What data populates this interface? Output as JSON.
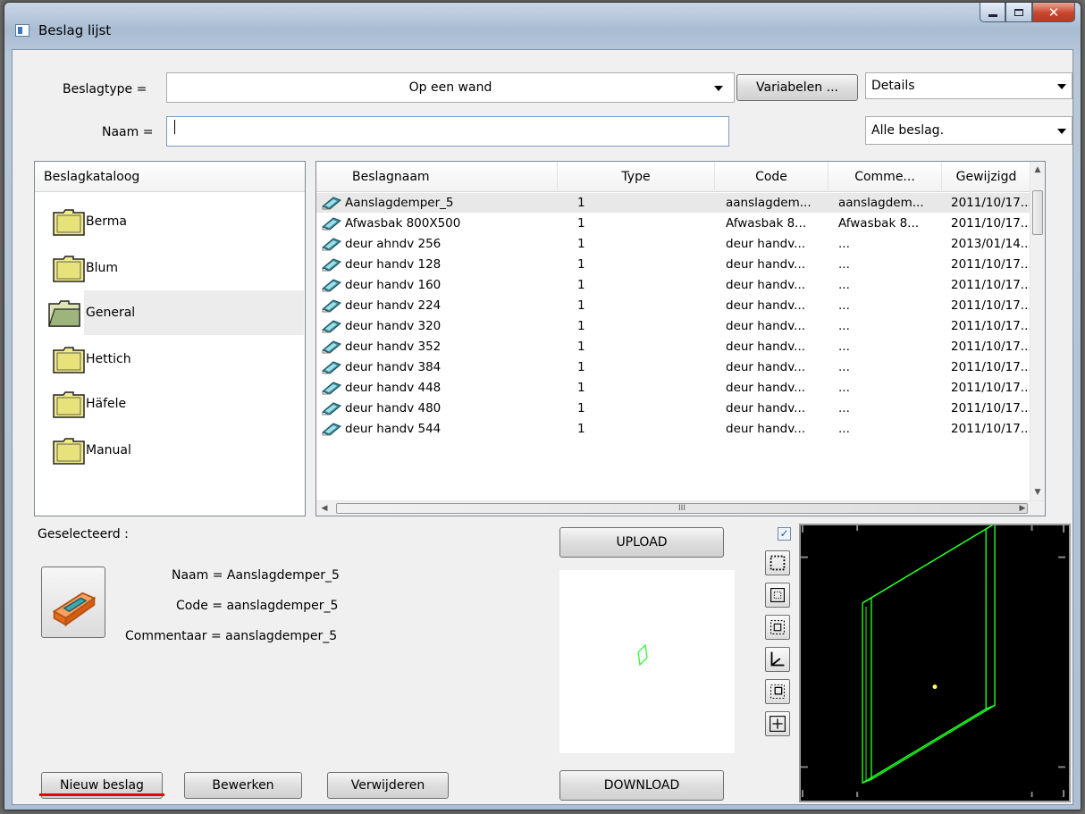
{
  "window": {
    "title": "Beslag lijst"
  },
  "top": {
    "beslagtype_label": "Beslagtype =",
    "beslagtype_value": "Op een wand",
    "variabelen_button": "Variabelen ...",
    "view_mode_value": "Details",
    "naam_label": "Naam =",
    "naam_value": "",
    "filter_value": "Alle beslag."
  },
  "catalog": {
    "title": "Beslagkataloog",
    "items": [
      {
        "label": "Berma"
      },
      {
        "label": "Blum"
      },
      {
        "label": "General"
      },
      {
        "label": "Hettich"
      },
      {
        "label": "Häfele"
      },
      {
        "label": "Manual"
      }
    ],
    "selected": "General"
  },
  "table": {
    "columns": [
      "Beslagnaam",
      "Type",
      "Code",
      "Comme...",
      "Gewijzigd"
    ],
    "rows": [
      [
        "Aanslagdemper_5",
        "1",
        "aanslagdem...",
        "aanslagdem...",
        "2011/10/17..."
      ],
      [
        "Afwasbak 800X500",
        "1",
        "Afwasbak 8...",
        "Afwasbak 8...",
        "2011/10/17..."
      ],
      [
        "deur ahndv 256",
        "1",
        "deur handv...",
        "...",
        "2013/01/14..."
      ],
      [
        "deur handv 128",
        "1",
        "deur handv...",
        "...",
        "2011/10/17..."
      ],
      [
        "deur handv 160",
        "1",
        "deur handv...",
        "...",
        "2011/10/17..."
      ],
      [
        "deur handv 224",
        "1",
        "deur handv...",
        "...",
        "2011/10/17..."
      ],
      [
        "deur handv 320",
        "1",
        "deur handv...",
        "...",
        "2011/10/17..."
      ],
      [
        "deur handv 352",
        "1",
        "deur handv...",
        "...",
        "2011/10/17..."
      ],
      [
        "deur handv 384",
        "1",
        "deur handv...",
        "...",
        "2011/10/17..."
      ],
      [
        "deur handv 448",
        "1",
        "deur handv...",
        "...",
        "2011/10/17..."
      ],
      [
        "deur handv 480",
        "1",
        "deur handv...",
        "...",
        "2011/10/17..."
      ],
      [
        "deur handv 544",
        "1",
        "deur handv...",
        "...",
        "2011/10/17..."
      ]
    ],
    "hscroll_grip": "III"
  },
  "selected": {
    "label": "Geselecteerd :",
    "naam": "Naam = Aanslagdemper_5",
    "code": "Code = aanslagdemper_5",
    "commentaar": "Commentaar = aanslagdemper_5"
  },
  "buttons": {
    "upload": "UPLOAD",
    "download": "DOWNLOAD",
    "nieuw": "Nieuw beslag",
    "bewerken": "Bewerken",
    "verwijderen": "Verwijderen"
  },
  "view": {
    "checkbox_checked": true,
    "check_glyph": "✓"
  },
  "colors": {
    "wireframe": "#22ff22",
    "view_bg": "#000000",
    "highlight": "#e00000"
  }
}
